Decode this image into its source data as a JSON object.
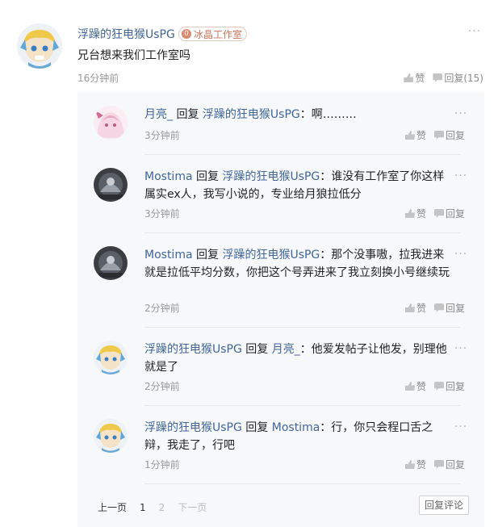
{
  "main_comment": {
    "username": "浮躁的狂电猴UsPG",
    "badge": "冰晶工作室",
    "badge_glyph": "0",
    "text": "兄台想来我们工作室吗",
    "time": "16分钟前",
    "like_label": "赞",
    "reply_label": "回复(15)",
    "more_glyph": "···",
    "avatar_kind": "anime-girl-avatar"
  },
  "replies": [
    {
      "username": "月亮_",
      "reply_word": "回复",
      "target": "浮躁的狂电猴UsPG",
      "sep": "：",
      "text": "啊………",
      "time": "3分钟前",
      "like_label": "赞",
      "reply_label": "回复",
      "more_glyph": "···",
      "avatar_kind": "pink-anime-avatar"
    },
    {
      "username": "Mostima",
      "reply_word": "回复",
      "target": "浮躁的狂电猴UsPG",
      "sep": "：",
      "text": "谁没有工作室了你这样属实ex人，我写小说的，专业给月狼拉低分",
      "time": "3分钟前",
      "like_label": "赞",
      "reply_label": "回复",
      "more_glyph": "···",
      "avatar_kind": "dark-photo-avatar"
    },
    {
      "username": "Mostima",
      "reply_word": "回复",
      "target": "浮躁的狂电猴UsPG",
      "sep": "：",
      "text": "那个没事嗷，拉我进来就是拉低平均分数，你把这个号弄进来了我立刻换小号继续玩",
      "time": "2分钟前",
      "like_label": "赞",
      "reply_label": "回复",
      "more_glyph": "···",
      "avatar_kind": "dark-photo-avatar"
    },
    {
      "username": "浮躁的狂电猴UsPG",
      "reply_word": "回复",
      "target": "月亮_",
      "sep": "：",
      "text": "他爱发帖子让他发，别理他就是了",
      "time": "2分钟前",
      "like_label": "赞",
      "reply_label": "回复",
      "more_glyph": "···",
      "avatar_kind": "anime-girl-avatar"
    },
    {
      "username": "浮躁的狂电猴UsPG",
      "reply_word": "回复",
      "target": "Mostima",
      "sep": "：",
      "text": "行，你只会程口舌之辩，我走了，行吧",
      "time": "1分钟前",
      "like_label": "赞",
      "reply_label": "回复",
      "more_glyph": "···",
      "avatar_kind": "anime-girl-avatar"
    }
  ],
  "pagination": {
    "prev": "上一页",
    "current": "1",
    "next_page": "2",
    "next": "下一页",
    "reply_comment_button": "回复评论"
  },
  "colors": {
    "username": "#406599",
    "muted": "#999999",
    "replies_bg": "#f7f8fa",
    "badge": "#c8765c"
  }
}
